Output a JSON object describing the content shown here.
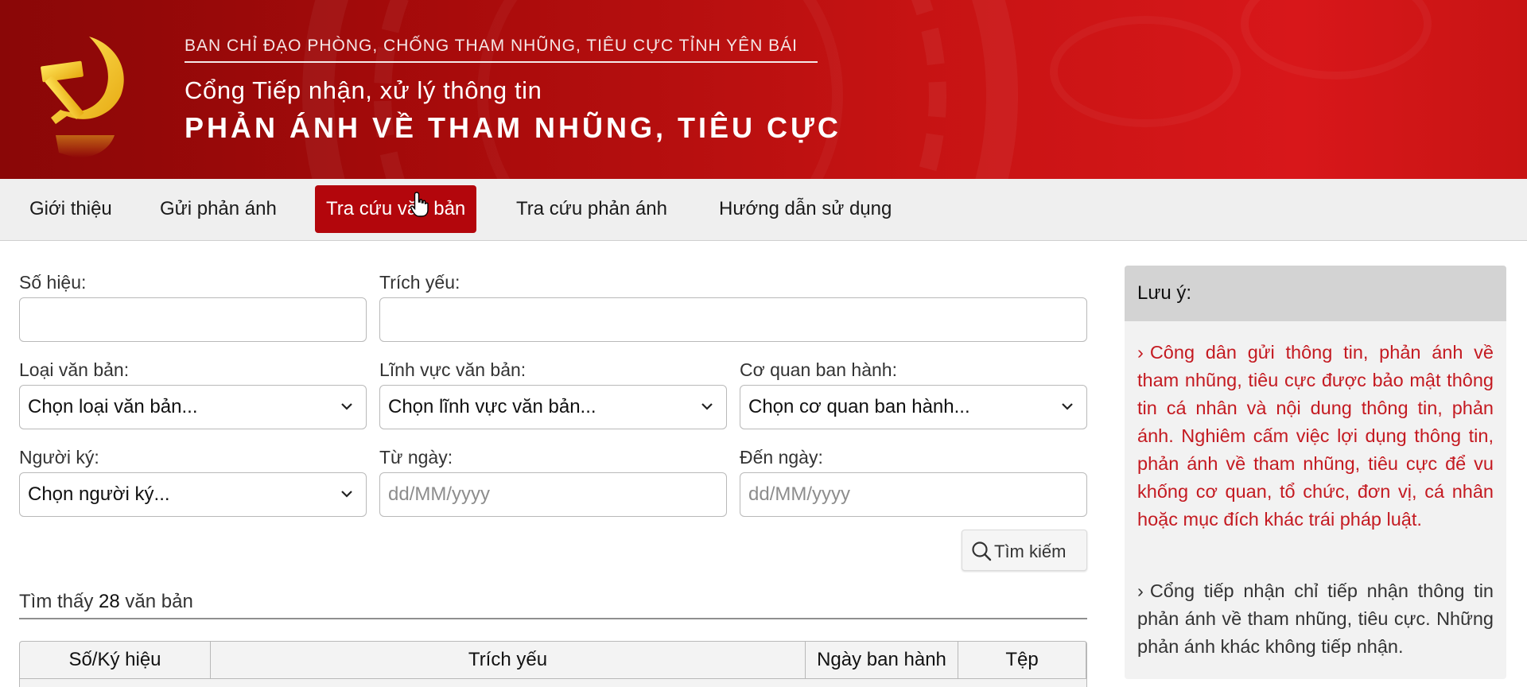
{
  "header": {
    "org": "BAN CHỈ ĐẠO PHÒNG, CHỐNG THAM NHŨNG, TIÊU CỰC TỈNH YÊN BÁI",
    "portal": "Cổng Tiếp nhận, xử lý thông tin",
    "title": "PHẢN ÁNH VỀ THAM NHŨNG, TIÊU CỰC",
    "logo_icon": "hammer-sickle-icon"
  },
  "nav": {
    "items": [
      {
        "label": "Giới thiệu"
      },
      {
        "label": "Gửi phản ánh"
      },
      {
        "label": "Tra cứu văn bản",
        "active": true
      },
      {
        "label": "Tra cứu phản ánh"
      },
      {
        "label": "Hướng dẫn sử dụng"
      }
    ]
  },
  "form": {
    "so_hieu_label": "Số hiệu:",
    "so_hieu_value": "",
    "trich_yeu_label": "Trích yếu:",
    "trich_yeu_value": "",
    "loai_label": "Loại văn bản:",
    "loai_value": "Chọn loại văn bản...",
    "linh_vuc_label": "Lĩnh vực văn bản:",
    "linh_vuc_value": "Chọn lĩnh vực văn bản...",
    "co_quan_label": "Cơ quan ban hành:",
    "co_quan_value": "Chọn cơ quan ban hành...",
    "nguoi_ky_label": "Người ký:",
    "nguoi_ky_value": "Chọn người ký...",
    "tu_ngay_label": "Từ ngày:",
    "tu_ngay_placeholder": "dd/MM/yyyy",
    "den_ngay_label": "Đến ngày:",
    "den_ngay_placeholder": "dd/MM/yyyy",
    "search_label": "Tìm kiếm"
  },
  "results": {
    "prefix": "Tìm thấy",
    "count": "28",
    "suffix": "văn bản"
  },
  "table": {
    "headers": [
      "Số/Ký hiệu",
      "Trích yếu",
      "Ngày ban hành",
      "Tệp"
    ]
  },
  "note": {
    "title": "Lưu ý:",
    "items": [
      "Công dân gửi thông tin, phản ánh về tham nhũng, tiêu cực được bảo mật thông tin cá nhân và nội dung thông tin, phản ánh. Nghiêm cấm việc lợi dụng thông tin, phản ánh về tham nhũng, tiêu cực để vu khống cơ quan, tổ chức, đơn vị, cá nhân hoặc mục đích khác trái pháp luật.",
      "Cổng tiếp nhận chỉ tiếp nhận thông tin phản ánh về tham nhũng, tiêu cực. Những phản ánh khác không tiếp nhận."
    ]
  },
  "colors": {
    "brand_red": "#b3060c",
    "note_red": "#c41a21",
    "logo_yellow": "#f6d21a"
  }
}
